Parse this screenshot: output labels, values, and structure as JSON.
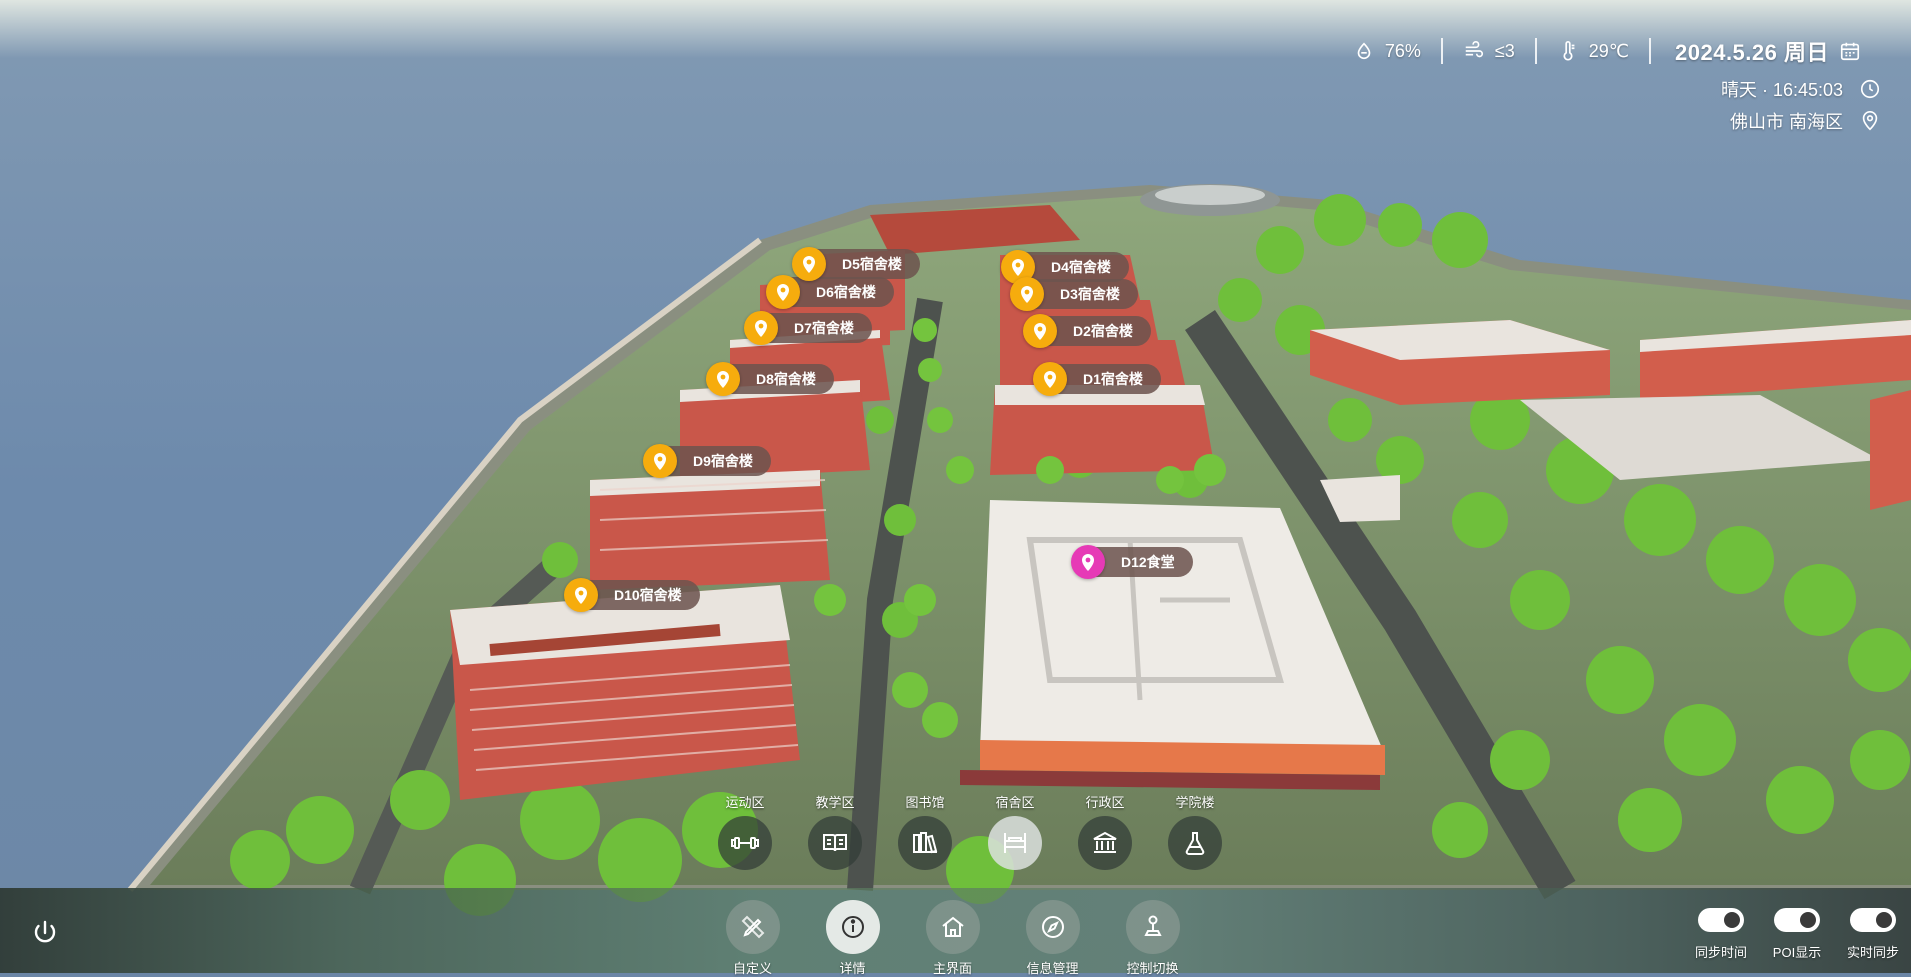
{
  "status": {
    "humidity": "76%",
    "wind": "≤3",
    "temperature": "29℃",
    "date": "2024.5.26 周日",
    "weather_time": "晴天 · 16:45:03",
    "location": "佛山市 南海区",
    "icons": [
      "humidity-icon",
      "wind-icon",
      "thermometer-icon",
      "calendar-icon",
      "clock-icon",
      "location-icon"
    ]
  },
  "pois": [
    {
      "label": "D5宿舍楼",
      "color": "#f6ac0d"
    },
    {
      "label": "D6宿舍楼",
      "color": "#f6ac0d"
    },
    {
      "label": "D7宿舍楼",
      "color": "#f6ac0d"
    },
    {
      "label": "D8宿舍楼",
      "color": "#f6ac0d"
    },
    {
      "label": "D9宿舍楼",
      "color": "#f6ac0d"
    },
    {
      "label": "D10宿舍楼",
      "color": "#f6ac0d"
    },
    {
      "label": "D4宿舍楼",
      "color": "#f6ac0d"
    },
    {
      "label": "D3宿舍楼",
      "color": "#f6ac0d"
    },
    {
      "label": "D2宿舍楼",
      "color": "#f6ac0d"
    },
    {
      "label": "D1宿舍楼",
      "color": "#f6ac0d"
    },
    {
      "label": "D12食堂",
      "color": "#e63ab6"
    }
  ],
  "zones": [
    {
      "label": "运动区",
      "icon": "dumbbell-icon",
      "active": false
    },
    {
      "label": "教学区",
      "icon": "book-icon",
      "active": false
    },
    {
      "label": "图书馆",
      "icon": "library-icon",
      "active": false
    },
    {
      "label": "宿舍区",
      "icon": "bed-icon",
      "active": true
    },
    {
      "label": "行政区",
      "icon": "government-building-icon",
      "active": false
    },
    {
      "label": "学院楼",
      "icon": "flask-icon",
      "active": false
    }
  ],
  "toolbar": [
    {
      "label": "自定义",
      "icon": "pencil-ruler-icon",
      "active": false
    },
    {
      "label": "详情",
      "icon": "info-icon",
      "active": true
    },
    {
      "label": "主界面",
      "icon": "home-icon",
      "active": false
    },
    {
      "label": "信息管理",
      "icon": "compass-icon",
      "active": false
    },
    {
      "label": "控制切换",
      "icon": "joystick-icon",
      "active": false
    }
  ],
  "toggles": [
    {
      "label": "同步时间",
      "on": true
    },
    {
      "label": "POI显示",
      "on": true
    },
    {
      "label": "实时同步",
      "on": true
    }
  ],
  "colors": {
    "poi_default": "#f6ac0d",
    "poi_canteen": "#e63ab6",
    "building_brick": "#c9574a",
    "roof": "#e9e4de",
    "tree": "#6fbf3b",
    "sky": "#6b86a6"
  }
}
